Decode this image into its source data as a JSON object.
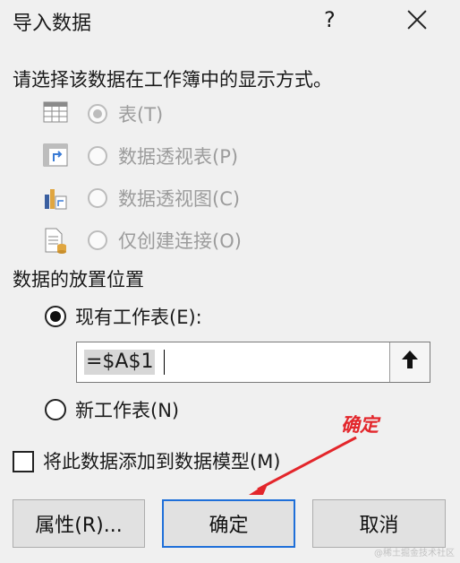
{
  "window": {
    "title": "导入数据",
    "help": "?"
  },
  "instruction": "请选择该数据在工作簿中的显示方式。",
  "display_options": [
    {
      "label": "表(T)",
      "checked": true,
      "disabled": true,
      "icon": "table-icon"
    },
    {
      "label": "数据透视表(P)",
      "checked": false,
      "disabled": true,
      "icon": "pivot-table-icon"
    },
    {
      "label": "数据透视图(C)",
      "checked": false,
      "disabled": true,
      "icon": "pivot-chart-icon"
    },
    {
      "label": "仅创建连接(O)",
      "checked": false,
      "disabled": true,
      "icon": "connection-only-icon"
    }
  ],
  "placement": {
    "heading": "数据的放置位置",
    "existing_sheet": {
      "label": "现有工作表(E):",
      "checked": true
    },
    "range_value": "=$A$1",
    "new_sheet": {
      "label": "新工作表(N)",
      "checked": false
    }
  },
  "data_model": {
    "label": "将此数据添加到数据模型(M)",
    "checked": false
  },
  "buttons": {
    "properties": "属性(R)...",
    "ok": "确定",
    "cancel": "取消"
  },
  "annotation": {
    "text": "确定",
    "color": "#e3262b"
  },
  "watermark": "@稀土掘金技术社区",
  "colors": {
    "primary_border": "#1e6fd9",
    "disabled_text": "#9c9c9c"
  }
}
